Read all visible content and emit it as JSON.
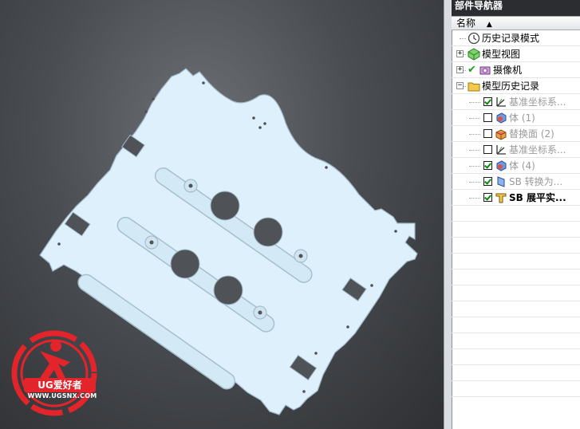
{
  "navigator": {
    "title": "部件导航器",
    "column_header": "名称",
    "sort_indicator": "▲",
    "items": [
      {
        "label": "历史记录模式",
        "level": 0,
        "icon": "clock-icon",
        "checked": null,
        "toggle": "",
        "dim": false
      },
      {
        "label": "模型视图",
        "level": 0,
        "icon": "cube-view-icon",
        "checked": null,
        "toggle": "+",
        "dim": false
      },
      {
        "label": "摄像机",
        "level": 0,
        "icon": "camera-icon",
        "checked": true,
        "toggle": "+",
        "dim": false
      },
      {
        "label": "模型历史记录",
        "level": 0,
        "icon": "folder-icon",
        "checked": null,
        "toggle": "−",
        "dim": false
      },
      {
        "label": "基准坐标系...",
        "level": 1,
        "icon": "datum-csys-icon",
        "checked": true,
        "toggle": "",
        "dim": true
      },
      {
        "label": "体 (1)",
        "level": 1,
        "icon": "body-icon",
        "checked": false,
        "toggle": "",
        "dim": true
      },
      {
        "label": "替换面 (2)",
        "level": 1,
        "icon": "replace-face-icon",
        "checked": false,
        "toggle": "",
        "dim": true
      },
      {
        "label": "基准坐标系...",
        "level": 1,
        "icon": "datum-csys-icon",
        "checked": false,
        "toggle": "",
        "dim": true
      },
      {
        "label": "体 (4)",
        "level": 1,
        "icon": "body-icon",
        "checked": true,
        "toggle": "",
        "dim": true
      },
      {
        "label": "SB 转换为...",
        "level": 1,
        "icon": "convert-sheetmetal-icon",
        "checked": true,
        "toggle": "",
        "dim": true
      },
      {
        "label": "SB 展平实...",
        "level": 1,
        "icon": "flat-solid-icon",
        "checked": true,
        "toggle": "",
        "dim": false,
        "bold": true
      }
    ]
  },
  "logo": {
    "brand": "UG爱好者",
    "url": "WWW.UGSNX.COM"
  },
  "colors": {
    "part_fill": "#ddf0fb",
    "part_edge": "#9fb6c4",
    "logo_red": "#e3242b"
  }
}
